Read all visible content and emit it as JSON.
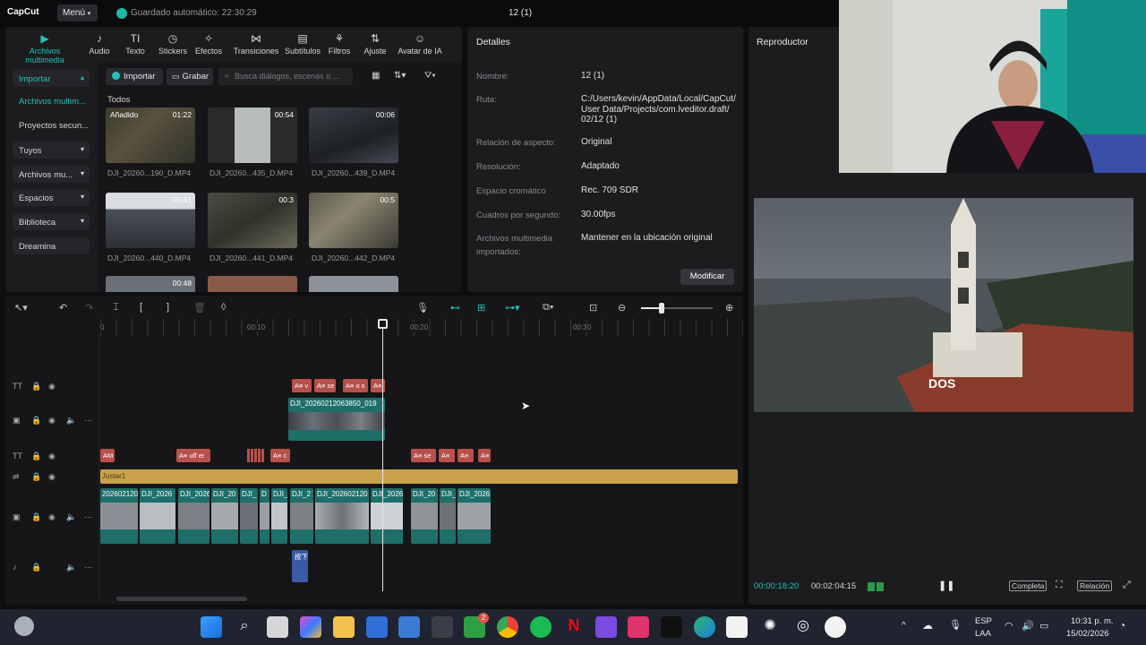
{
  "app": {
    "logo": "CapCut",
    "menu_label": "Menú",
    "autosave": "Guardado automático: 22:30:29",
    "project_title": "12 (1)"
  },
  "toolbar_tabs": [
    {
      "label": "Archivos multimedia",
      "icon": "media-icon",
      "glyph": "▶"
    },
    {
      "label": "Audio",
      "icon": "audio-icon",
      "glyph": "♪"
    },
    {
      "label": "Texto",
      "icon": "text-icon",
      "glyph": "TI"
    },
    {
      "label": "Stickers",
      "icon": "sticker-icon",
      "glyph": "◷"
    },
    {
      "label": "Efectos",
      "icon": "effects-icon",
      "glyph": "✧"
    },
    {
      "label": "Transiciones",
      "icon": "transition-icon",
      "glyph": "⋈"
    },
    {
      "label": "Subtítulos",
      "icon": "subtitle-icon",
      "glyph": "▤"
    },
    {
      "label": "Filtros",
      "icon": "filter-icon",
      "glyph": "⚘"
    },
    {
      "label": "Ajuste",
      "icon": "adjust-icon",
      "glyph": "⇅"
    },
    {
      "label": "Avatar de IA",
      "icon": "avatar-icon",
      "glyph": "☺"
    }
  ],
  "sidebar": {
    "import": "Importar",
    "media_local": "Archivos multim...",
    "secondary_projects": "Proyectos secun...",
    "yours": "Tuyos",
    "media_more": "Archivos mu...",
    "spaces": "Espacios",
    "library": "Biblioteca",
    "dreamina": "Dreamina"
  },
  "media": {
    "import_button": "Importar",
    "record_button": "Grabar",
    "search_placeholder": "Busca diálogos, escenas o ...",
    "section_all": "Todos",
    "added_badge": "Añadido",
    "items": [
      {
        "name": "DJI_20260...190_D.MP4",
        "duration": "01:22"
      },
      {
        "name": "DJI_20260...435_D.MP4",
        "duration": "00:54"
      },
      {
        "name": "DJI_20260...439_D.MP4",
        "duration": "00:06"
      },
      {
        "name": "DJI_20260...440_D.MP4",
        "duration": "00:41"
      },
      {
        "name": "DJI_20260...441_D.MP4",
        "duration": "00:3"
      },
      {
        "name": "DJI_20260...442_D.MP4",
        "duration": "00:5"
      },
      {
        "name": "",
        "duration": "00:48"
      }
    ]
  },
  "details": {
    "title": "Detalles",
    "rows": [
      {
        "label": "Nombre:",
        "value": "12 (1)"
      },
      {
        "label": "Ruta:",
        "value": "C:/Users/kevin/AppData/Local/CapCut/ User Data/Projects/com.lveditor.draft/ 02/12 (1)"
      },
      {
        "label": "Relación de aspecto:",
        "value": "Original"
      },
      {
        "label": "Resolución:",
        "value": "Adaptado"
      },
      {
        "label": "Espacio cromático",
        "value": "Rec. 709 SDR"
      },
      {
        "label": "Cuadros por segundo:",
        "value": "30.00fps"
      },
      {
        "label": "Archivos multimedia importados:",
        "value": "Mantener en la ubicación original"
      }
    ],
    "modify_button": "Modificar"
  },
  "player": {
    "title": "Reproductor",
    "overlay_text": "DOS",
    "time_current": "00:00:18:20",
    "time_total": "00:02:04:15",
    "full_button": "Completa",
    "ratio_button": "Relación"
  },
  "timeline": {
    "ruler": [
      "0",
      "00:10",
      "00:20",
      "00:30"
    ],
    "video_clip_top": "DJI_20260212063850_019",
    "adjust_label": "Justar1",
    "title_clips_top": [
      "A≡ v",
      "A≡ se",
      "A≡ o s",
      "A≡"
    ],
    "title_clips_mid": [
      "AM",
      "A≡ uff er",
      "A≡ c",
      "A≡ se",
      "A≡",
      "A≡",
      "A≡"
    ],
    "main_clips": [
      "2026021206",
      "DJI_2026",
      "DJI_2026",
      "DJI_20",
      "DJI_",
      "D",
      "DJI_",
      "DJI_2",
      "DJI_202602120",
      "DJI_2026",
      "DJI_20",
      "DJI_",
      "DJI_2026"
    ],
    "audio_label": "按下"
  },
  "taskbar": {
    "lang": "ESP",
    "lang_sub": "LAA",
    "time": "10:31 p. m.",
    "date": "15/02/2026",
    "xbox_badge": "2"
  },
  "colors": {
    "accent": "#21c2b5",
    "title_clip": "#b9504b",
    "video_clip": "#1e6f6a",
    "adjust_clip": "#c9a24a",
    "audio_clip": "#3a5aa8"
  }
}
